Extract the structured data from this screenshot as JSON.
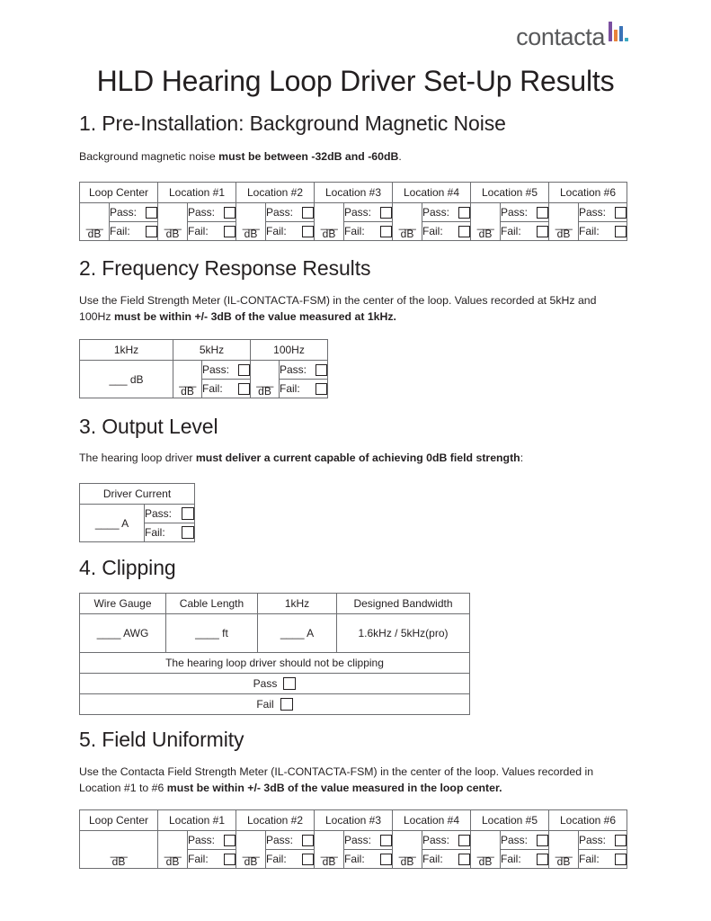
{
  "brand": {
    "name": "contacta",
    "mark_colors": [
      "#7b4fa0",
      "#e8833a",
      "#3a73b8",
      "#3aa8c1"
    ]
  },
  "document": {
    "title": "HLD Hearing Loop Driver Set-Up Results"
  },
  "labels": {
    "pass": "Pass:",
    "fail": "Fail:",
    "pass_plain": "Pass",
    "fail_plain": "Fail",
    "blank_dashes": "___",
    "unit_db": "dB",
    "blank_db": "___ dB",
    "blank_amp": "____ A",
    "blank_awg": "____ AWG",
    "blank_ft": "____ ft",
    "blank_amp_short": "___ A"
  },
  "sections": [
    {
      "number": "1.",
      "heading": "1. Pre-Installation: Background Magnetic Noise",
      "intro_plain": "Background magnetic noise ",
      "intro_bold": "must be between -32dB and -60dB",
      "intro_tail": ".",
      "table": {
        "headers": [
          "Loop Center",
          "Location #1",
          "Location #2",
          "Location #3",
          "Location #4",
          "Location #5",
          "Location #6"
        ],
        "loop_center_has_passfail": true,
        "value_placeholder": "___",
        "unit": "dB"
      }
    },
    {
      "number": "2.",
      "heading": "2. Frequency Response Results",
      "intro_plain": "Use the Field Strength Meter (IL-CONTACTA-FSM) in the center of the loop. Values recorded at 5kHz and 100Hz ",
      "intro_bold": "must be within +/- 3dB of the value measured at 1kHz.",
      "intro_tail": "",
      "table": {
        "headers": [
          "1kHz",
          "5kHz",
          "100Hz"
        ],
        "first_cell_value": "___ dB",
        "value_placeholder": "___",
        "unit": "dB"
      }
    },
    {
      "number": "3.",
      "heading": "3. Output Level",
      "intro_plain": "The hearing loop driver ",
      "intro_bold": "must deliver a current capable of achieving 0dB field strength",
      "intro_tail": ":",
      "table": {
        "headers": [
          "Driver Current"
        ],
        "value": "____ A"
      }
    },
    {
      "number": "4.",
      "heading": "4. Clipping",
      "table": {
        "headers": [
          "Wire Gauge",
          "Cable Length",
          "1kHz",
          "Designed Bandwidth"
        ],
        "values": [
          "____ AWG",
          "____ ft",
          "____ A",
          "1.6kHz / 5kHz(pro)"
        ],
        "banner": "The hearing loop driver should not be clipping",
        "rows": [
          "Pass",
          "Fail"
        ]
      }
    },
    {
      "number": "5.",
      "heading": "5. Field Uniformity",
      "intro_plain": "Use the Contacta Field Strength Meter (IL-CONTACTA-FSM) in the center of the loop. Values recorded in Location #1 to #6 ",
      "intro_bold": "must be within +/- 3dB of the value measured in the loop center.",
      "intro_tail": "",
      "table": {
        "headers": [
          "Loop Center",
          "Location #1",
          "Location #2",
          "Location #3",
          "Location #4",
          "Location #5",
          "Location #6"
        ],
        "loop_center_has_passfail": false,
        "loop_center_value": "___ dB",
        "value_placeholder": "___",
        "unit": "dB"
      }
    }
  ]
}
